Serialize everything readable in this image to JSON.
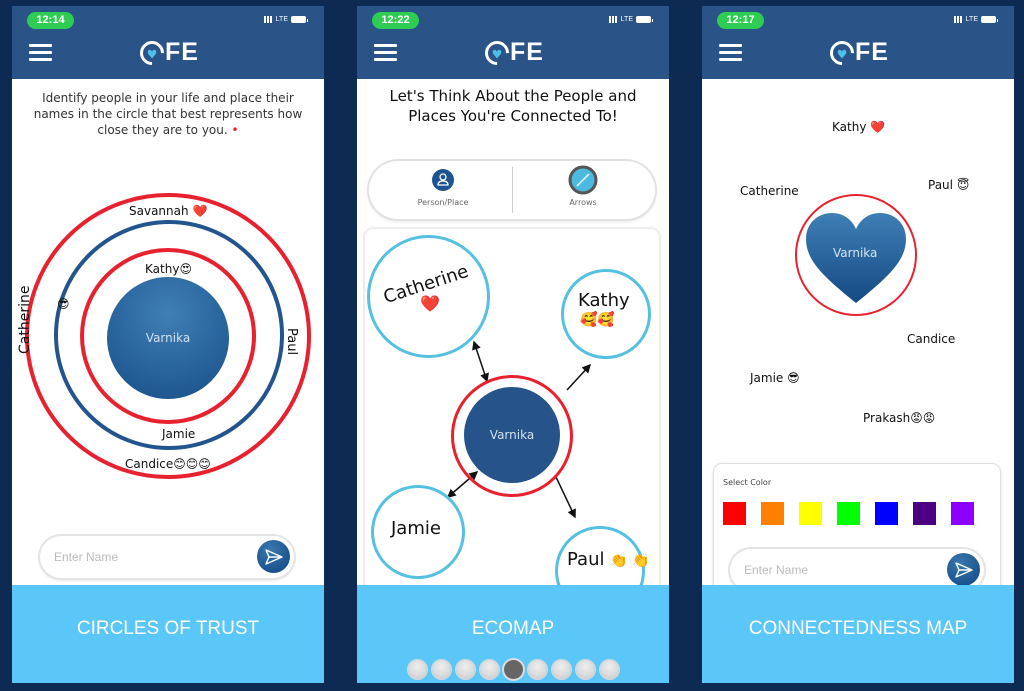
{
  "app": {
    "logo_text": "FE",
    "logo_icon": "heart-c-icon"
  },
  "screens": [
    {
      "status": {
        "time": "12:14",
        "network": "LTE"
      },
      "instruction": "Identify people in your life and place their names in the circle that best represents how close they are to you.",
      "required_mark": "•",
      "center_name": "Varnika",
      "people": [
        {
          "name": "Savannah",
          "emoji": "❤️"
        },
        {
          "name": "Kathy",
          "emoji": "😍"
        },
        {
          "name": "Catherine",
          "emoji": "😎"
        },
        {
          "name": "Paul",
          "emoji": ""
        },
        {
          "name": "Jamie",
          "emoji": ""
        },
        {
          "name": "Candice",
          "emoji": "😊😊😊"
        }
      ],
      "input_placeholder": "Enter Name",
      "footer_label": "CIRCLES OF TRUST"
    },
    {
      "status": {
        "time": "12:22",
        "network": "LTE"
      },
      "title": "Let's Think About the People and Places You're Connected To!",
      "tools": [
        {
          "label": "Person/Place",
          "icon": "person-icon"
        },
        {
          "label": "Arrows",
          "icon": "arrow-line-icon"
        }
      ],
      "center_name": "Varnika",
      "nodes": [
        {
          "name": "Catherine",
          "emoji": "❤️"
        },
        {
          "name": "Kathy",
          "emoji": "🥰🥰"
        },
        {
          "name": "Jamie",
          "emoji": ""
        },
        {
          "name": "Paul",
          "emoji": "👏 👏"
        }
      ],
      "footer_label": "ECOMAP",
      "pager": {
        "total": 9,
        "active_index": 4
      }
    },
    {
      "status": {
        "time": "12:17",
        "network": "LTE"
      },
      "center_name": "Varnika",
      "people": [
        {
          "name": "Kathy",
          "emoji": "❤️"
        },
        {
          "name": "Catherine",
          "emoji": ""
        },
        {
          "name": "Paul",
          "emoji": "😇"
        },
        {
          "name": "Candice",
          "emoji": ""
        },
        {
          "name": "Jamie",
          "emoji": "😎"
        },
        {
          "name": "Prakash",
          "emoji": "😡😡"
        }
      ],
      "select_color_label": "Select Color",
      "colors": [
        "#ff0000",
        "#ff7f00",
        "#ffff00",
        "#00ff00",
        "#0000ff",
        "#4b0082",
        "#8b00ff"
      ],
      "input_placeholder": "Enter Name",
      "footer_label": "CONNECTEDNESS MAP"
    }
  ]
}
